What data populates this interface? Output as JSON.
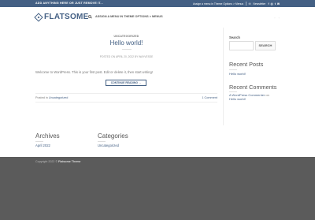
{
  "topbar": {
    "announcement": "ADD ANYTHING HERE OR JUST REMOVE IT...",
    "menu_hint": "Assign a menu in Theme Options > Menus",
    "newsletter": "Newsletter",
    "social_icons": [
      "facebook-icon",
      "instagram-icon",
      "twitter-icon",
      "email-icon"
    ]
  },
  "header": {
    "logo_text": "FLATSOME",
    "nav_text": "ASSIGN A MENU IN THEME OPTIONS > MENUS"
  },
  "post": {
    "category": "UNCATEGORIZED",
    "title": "Hello world!",
    "meta": "POSTED ON APRIL 20, 2022 BY WAYVESSE",
    "excerpt": "Welcome to WordPress. This is your first post. Edit or delete it, then start writing!",
    "button_label": "CONTINUE READING →",
    "posted_in_label": "Posted in",
    "posted_in_category": "Uncategorized",
    "comments": "1 Comment"
  },
  "sidebar": {
    "search_label": "Search",
    "search_placeholder": "",
    "search_button": "SEARCH",
    "recent_posts_title": "Recent Posts",
    "recent_posts": [
      "Hello world!"
    ],
    "recent_comments_title": "Recent Comments",
    "recent_comment_author": "A WordPress Commenter",
    "recent_comment_on": "on",
    "recent_comment_post": "Hello world!"
  },
  "footer_widgets": {
    "archives_title": "Archives",
    "archives_item": "April 2022",
    "categories_title": "Categories",
    "categories_item": "Uncategorized"
  },
  "footer": {
    "copyright_prefix": "Copyright 2022 ©",
    "copyright_brand": "Flatsome Theme"
  },
  "colors": {
    "primary": "#446084",
    "footer_bg": "#5b5b5b"
  }
}
